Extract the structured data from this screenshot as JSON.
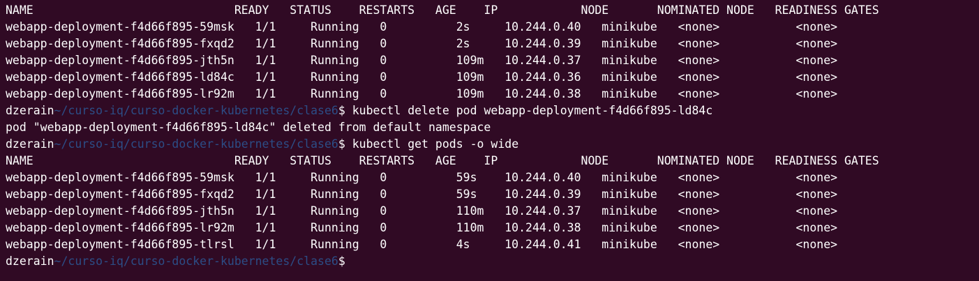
{
  "terminal": {
    "background": "#300a24",
    "foreground": "#ffffff",
    "path_color": "#2c4d86",
    "lines": [
      {
        "kind": "output",
        "text": "NAME                             READY   STATUS    RESTARTS   AGE    IP            NODE       NOMINATED NODE   READINESS GATES"
      },
      {
        "kind": "output",
        "text": "webapp-deployment-f4d66f895-59msk   1/1     Running   0          2s     10.244.0.40   minikube   <none>           <none>"
      },
      {
        "kind": "output",
        "text": "webapp-deployment-f4d66f895-fxqd2   1/1     Running   0          2s     10.244.0.39   minikube   <none>           <none>"
      },
      {
        "kind": "output",
        "text": "webapp-deployment-f4d66f895-jth5n   1/1     Running   0          109m   10.244.0.37   minikube   <none>           <none>"
      },
      {
        "kind": "output",
        "text": "webapp-deployment-f4d66f895-ld84c   1/1     Running   0          109m   10.244.0.36   minikube   <none>           <none>"
      },
      {
        "kind": "output",
        "text": "webapp-deployment-f4d66f895-lr92m   1/1     Running   0          109m   10.244.0.38   minikube   <none>           <none>"
      },
      {
        "kind": "prompt",
        "user": "dzerain",
        "path": "~/curso-iq/curso-docker-kubernetes/clase6",
        "symbol": "$ ",
        "command": "kubectl delete pod webapp-deployment-f4d66f895-ld84c"
      },
      {
        "kind": "output",
        "text": "pod \"webapp-deployment-f4d66f895-ld84c\" deleted from default namespace"
      },
      {
        "kind": "prompt",
        "user": "dzerain",
        "path": "~/curso-iq/curso-docker-kubernetes/clase6",
        "symbol": "$ ",
        "command": "kubectl get pods -o wide"
      },
      {
        "kind": "output",
        "text": "NAME                             READY   STATUS    RESTARTS   AGE    IP            NODE       NOMINATED NODE   READINESS GATES"
      },
      {
        "kind": "output",
        "text": "webapp-deployment-f4d66f895-59msk   1/1     Running   0          59s    10.244.0.40   minikube   <none>           <none>"
      },
      {
        "kind": "output",
        "text": "webapp-deployment-f4d66f895-fxqd2   1/1     Running   0          59s    10.244.0.39   minikube   <none>           <none>"
      },
      {
        "kind": "output",
        "text": "webapp-deployment-f4d66f895-jth5n   1/1     Running   0          110m   10.244.0.37   minikube   <none>           <none>"
      },
      {
        "kind": "output",
        "text": "webapp-deployment-f4d66f895-lr92m   1/1     Running   0          110m   10.244.0.38   minikube   <none>           <none>"
      },
      {
        "kind": "output",
        "text": "webapp-deployment-f4d66f895-tlrsl   1/1     Running   0          4s     10.244.0.41   minikube   <none>           <none>"
      },
      {
        "kind": "prompt",
        "user": "dzerain",
        "path": "~/curso-iq/curso-docker-kubernetes/clase6",
        "symbol": "$",
        "command": ""
      }
    ]
  }
}
